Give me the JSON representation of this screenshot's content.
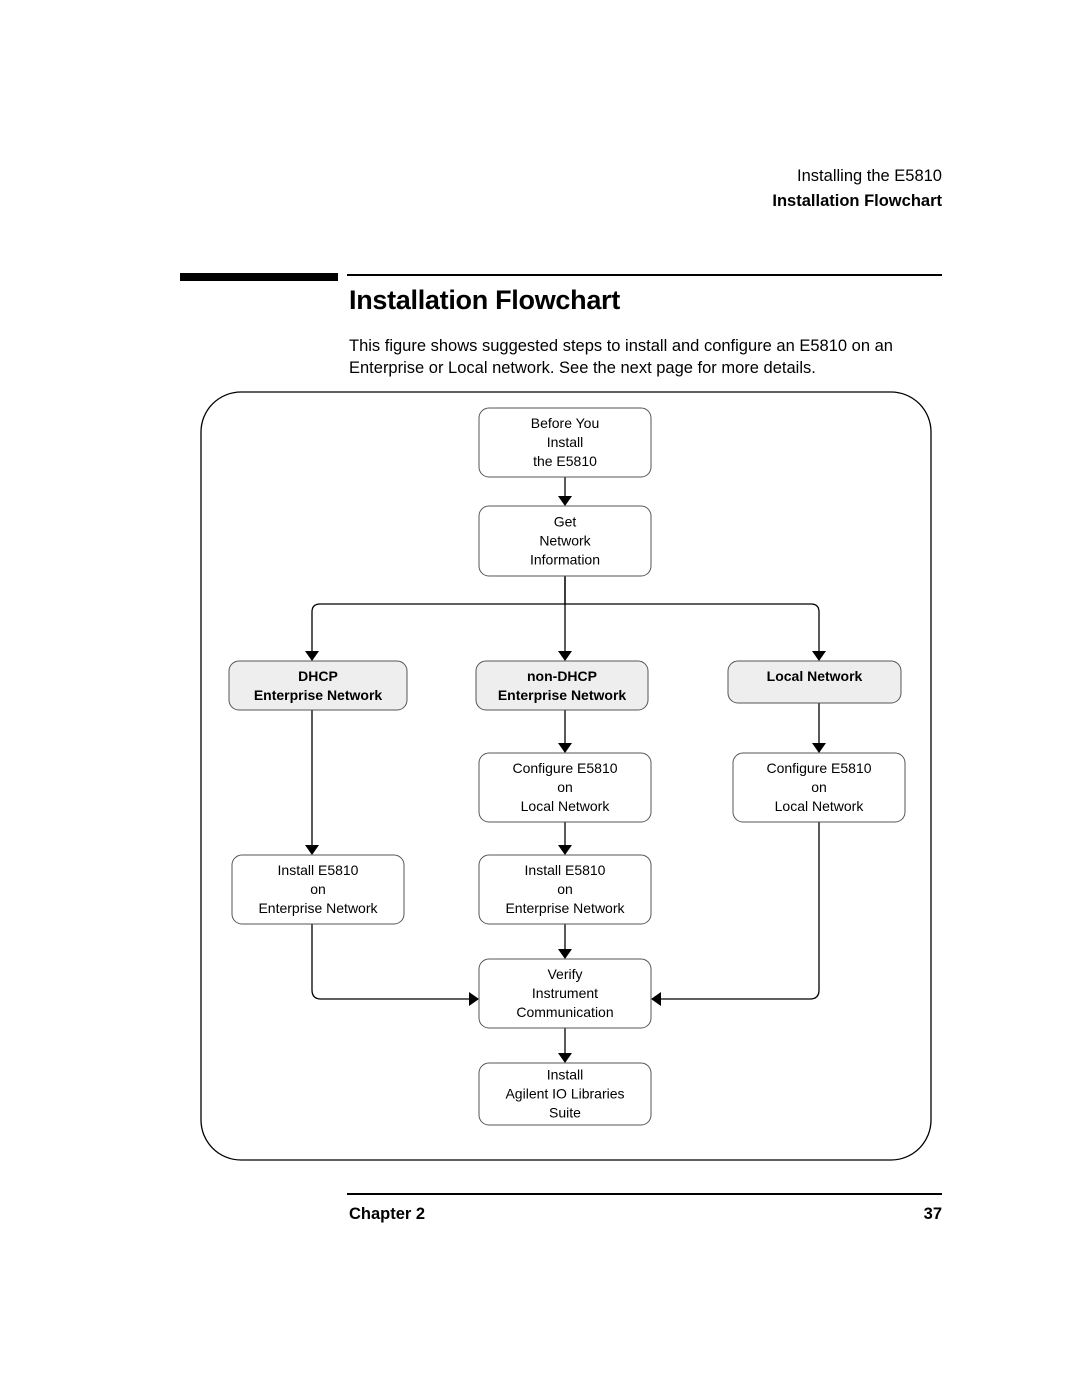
{
  "header": {
    "section": "Installing the E5810",
    "subsection": "Installation Flowchart"
  },
  "page_title": "Installation Flowchart",
  "intro_text": "This figure shows suggested steps to install and configure an E5810 on an Enterprise or Local network. See the next page for more details.",
  "flowchart": {
    "nodes": [
      {
        "id": "before-install",
        "lines": [
          "Before You",
          "Install",
          "the E5810"
        ],
        "shaded": false
      },
      {
        "id": "get-network-info",
        "lines": [
          "Get",
          "Network",
          "Information"
        ],
        "shaded": false
      },
      {
        "id": "dhcp-enterprise",
        "lines": [
          "DHCP",
          "Enterprise Network"
        ],
        "shaded": true
      },
      {
        "id": "non-dhcp-enterprise",
        "lines": [
          "non-DHCP",
          "Enterprise Network"
        ],
        "shaded": true
      },
      {
        "id": "local-network",
        "lines": [
          "Local Network"
        ],
        "shaded": true
      },
      {
        "id": "configure-local-mid",
        "lines": [
          "Configure E5810",
          "on",
          "Local Network"
        ],
        "shaded": false
      },
      {
        "id": "configure-local-right",
        "lines": [
          "Configure E5810",
          "on",
          "Local Network"
        ],
        "shaded": false
      },
      {
        "id": "install-enterprise-left",
        "lines": [
          "Install E5810",
          "on",
          "Enterprise Network"
        ],
        "shaded": false
      },
      {
        "id": "install-enterprise-mid",
        "lines": [
          "Install E5810",
          "on",
          "Enterprise Network"
        ],
        "shaded": false
      },
      {
        "id": "verify-communication",
        "lines": [
          "Verify",
          "Instrument",
          "Communication"
        ],
        "shaded": false
      },
      {
        "id": "install-io-libraries",
        "lines": [
          "Install",
          "Agilent IO Libraries",
          "Suite"
        ],
        "shaded": false
      }
    ],
    "edges": [
      [
        "before-install",
        "get-network-info"
      ],
      [
        "get-network-info",
        "dhcp-enterprise"
      ],
      [
        "get-network-info",
        "non-dhcp-enterprise"
      ],
      [
        "get-network-info",
        "local-network"
      ],
      [
        "dhcp-enterprise",
        "install-enterprise-left"
      ],
      [
        "non-dhcp-enterprise",
        "configure-local-mid"
      ],
      [
        "local-network",
        "configure-local-right"
      ],
      [
        "configure-local-mid",
        "install-enterprise-mid"
      ],
      [
        "install-enterprise-mid",
        "verify-communication"
      ],
      [
        "install-enterprise-left",
        "verify-communication"
      ],
      [
        "configure-local-right",
        "verify-communication"
      ],
      [
        "verify-communication",
        "install-io-libraries"
      ]
    ],
    "colors": {
      "shaded_fill": "#eeeeee",
      "stroke": "#555555",
      "line": "#000000"
    }
  },
  "footer": {
    "chapter": "Chapter 2",
    "page_number": "37"
  }
}
